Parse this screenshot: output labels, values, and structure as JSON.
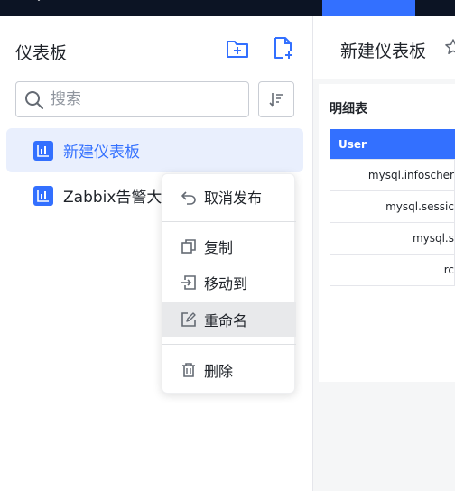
{
  "sidebar": {
    "title": "仪表板",
    "search_placeholder": "搜索",
    "items": [
      {
        "label": "新建仪表板",
        "selected": true
      },
      {
        "label": "Zabbix告警大"
      }
    ]
  },
  "context_menu": {
    "items": [
      {
        "label": "取消发布",
        "icon": "undo-icon"
      },
      {
        "label": "复制",
        "icon": "copy-icon"
      },
      {
        "label": "移动到",
        "icon": "move-icon"
      },
      {
        "label": "重命名",
        "icon": "rename-icon",
        "hover": true
      },
      {
        "label": "删除",
        "icon": "trash-icon"
      }
    ]
  },
  "main": {
    "title": "新建仪表板",
    "panel": {
      "title": "明细表",
      "column_header": "User",
      "rows": [
        "mysql.infoscher",
        "mysql.sessic",
        "mysql.s",
        "rc"
      ]
    }
  },
  "colors": {
    "accent": "#3370ff",
    "topbar": "#0c1424",
    "selected_bg": "#e9effd"
  }
}
